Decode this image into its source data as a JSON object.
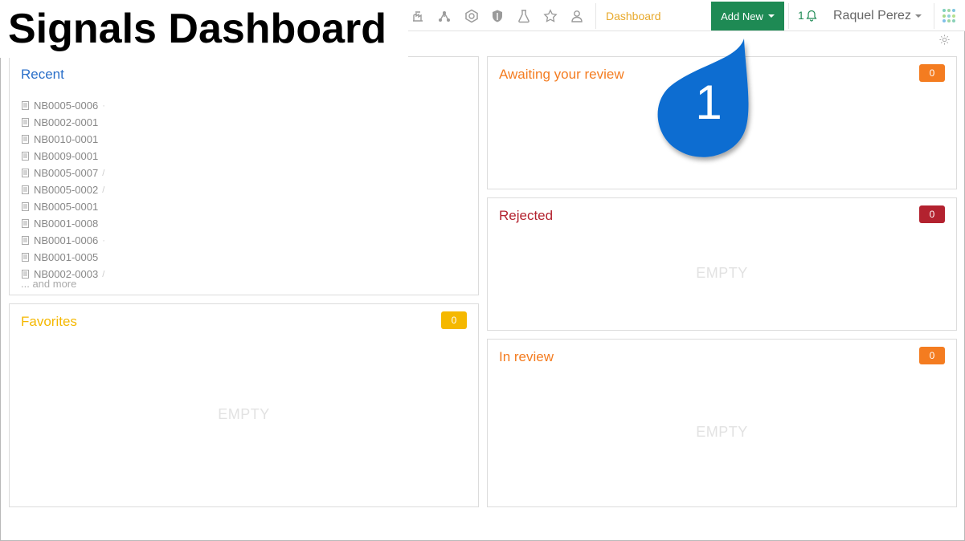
{
  "page_title": "Signals Dashboard",
  "nav": {
    "dashboard_label": "Dashboard",
    "add_new_label": "Add New",
    "notification_count": "1",
    "user_name": "Raquel Perez",
    "icons": [
      "flask-building-icon",
      "network-icon",
      "hexagon-icon",
      "shield-icon",
      "beaker-icon",
      "star-icon",
      "users-icon"
    ]
  },
  "panels": {
    "recent": {
      "title": "Recent",
      "items": [
        {
          "label": "NB0005-0006",
          "trail": "·"
        },
        {
          "label": "NB0002-0001",
          "trail": ""
        },
        {
          "label": "NB0010-0001",
          "trail": ""
        },
        {
          "label": "NB0009-0001",
          "trail": ""
        },
        {
          "label": "NB0005-0007",
          "trail": "/"
        },
        {
          "label": "NB0005-0002",
          "trail": "/"
        },
        {
          "label": "NB0005-0001",
          "trail": ""
        },
        {
          "label": "NB0001-0008",
          "trail": ""
        },
        {
          "label": "NB0001-0006",
          "trail": "·"
        },
        {
          "label": "NB0001-0005",
          "trail": ""
        },
        {
          "label": "NB0002-0003",
          "trail": "/"
        }
      ],
      "more_label": "... and more"
    },
    "favorites": {
      "title": "Favorites",
      "count": "0",
      "empty_label": "EMPTY"
    },
    "awaiting": {
      "title": "Awaiting your review",
      "count": "0"
    },
    "rejected": {
      "title": "Rejected",
      "count": "0",
      "empty_label": "EMPTY"
    },
    "in_review": {
      "title": "In review",
      "count": "0",
      "empty_label": "EMPTY"
    }
  },
  "callout": {
    "number": "1"
  },
  "colors": {
    "accent_green": "#1e8a54",
    "favorites": "#f5b800",
    "awaiting": "#f47c20",
    "rejected": "#b3222f",
    "in_review": "#f47c20",
    "recent": "#2a6fc9",
    "callout": "#0a6dd1"
  }
}
